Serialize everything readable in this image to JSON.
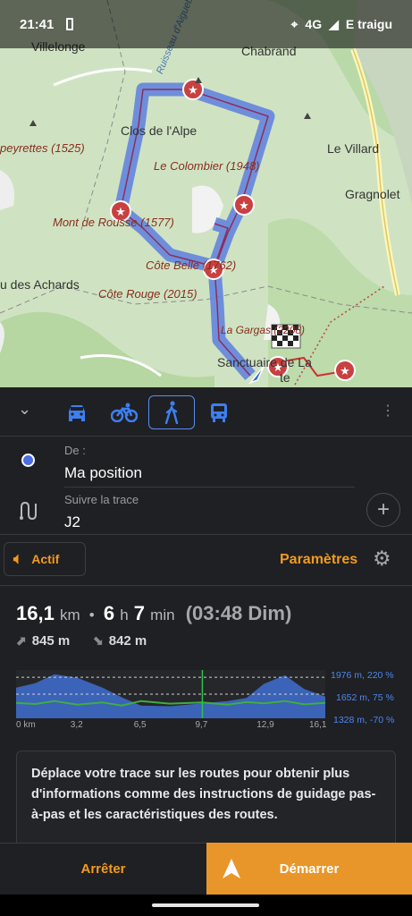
{
  "status_bar": {
    "time": "21:41",
    "network": "4G",
    "partial_label": "E traigu"
  },
  "map": {
    "labels": [
      "Villelonge",
      "Chabrand",
      "Ruisseau d'Aiguebelle",
      "Clos de l'Alpe",
      "peyrettes (1525)",
      "Le Colombier (1948)",
      "Le Villard",
      "Gragnolet",
      "Mont de Rousse (1577)",
      "Côte Belle (1762)",
      "u des Achards",
      "Côte Rouge (2015)",
      "La Gargas (2208)",
      "Sanctuaire de La",
      "te"
    ]
  },
  "modes": [
    "car",
    "bike",
    "walk",
    "bus"
  ],
  "route": {
    "from_label": "De :",
    "from_value": "Ma position",
    "follow_label": "Suivre la trace",
    "follow_value": "J2"
  },
  "sound": {
    "label": "Actif"
  },
  "settings": {
    "label": "Paramètres"
  },
  "stats": {
    "distance": "16,1",
    "distance_unit": "km",
    "hours": "6",
    "hours_unit": "h",
    "minutes": "7",
    "minutes_unit": "min",
    "arrival": "(03:48 Dim)",
    "ascent": "845 m",
    "descent": "842 m"
  },
  "chart_data": {
    "type": "area",
    "x_ticks": [
      "0 km",
      "3,2",
      "6,5",
      "9,7",
      "12,9",
      "16,1"
    ],
    "x_unit": "km",
    "right_labels": [
      "1976 m, 220 %",
      "1652 m, 75 %",
      "1328 m, -70 %"
    ],
    "series": [
      {
        "name": "elevation",
        "color": "#3f6fd0",
        "x": [
          0,
          1,
          2,
          3.2,
          4.5,
          5.5,
          6.5,
          8,
          9.7,
          11,
          12,
          12.9,
          14,
          15,
          16.1
        ],
        "y": [
          1740,
          1800,
          1920,
          1870,
          1740,
          1610,
          1500,
          1490,
          1530,
          1560,
          1600,
          1790,
          1905,
          1720,
          1620
        ]
      },
      {
        "name": "slope",
        "color": "#3fae3f",
        "x": [
          0,
          1,
          2,
          3.2,
          4.5,
          5.5,
          6.5,
          8,
          9.7,
          11,
          12,
          12.9,
          14,
          15,
          16.1
        ],
        "y": [
          1535,
          1520,
          1560,
          1510,
          1540,
          1500,
          1560,
          1525,
          1540,
          1510,
          1545,
          1530,
          1560,
          1515,
          1535
        ]
      }
    ],
    "ylim": [
      1328,
      1976
    ]
  },
  "info": {
    "text": "Déplace votre trace sur les routes pour obtenir plus d'informations comme des instructions de guidage pas-à-pas et les caractéristiques des routes."
  },
  "buttons": {
    "stop": "Arrêter",
    "start": "Démarrer"
  },
  "colors": {
    "accent": "#f39a1f",
    "start_bg": "#e8962a",
    "route": "#3f6fd0",
    "panel": "#1f2023"
  }
}
